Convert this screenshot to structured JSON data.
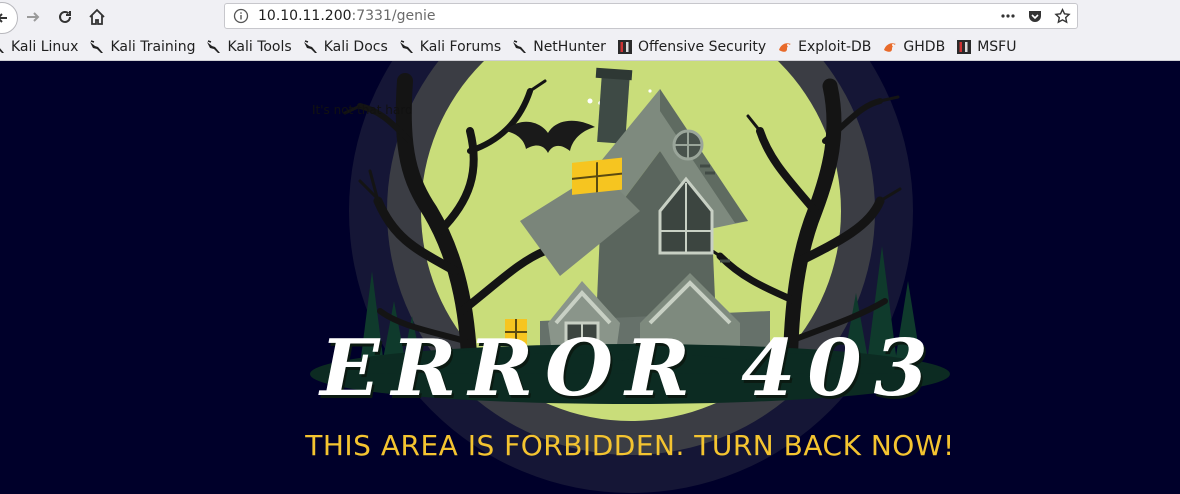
{
  "browser": {
    "url_host": "10.10.11.200",
    "url_rest": ":7331/genie"
  },
  "bookmarks": [
    {
      "label": "Kali Linux",
      "icon": "kali-dragon-icon"
    },
    {
      "label": "Kali Training",
      "icon": "kali-dragon-icon"
    },
    {
      "label": "Kali Tools",
      "icon": "kali-dragon-icon"
    },
    {
      "label": "Kali Docs",
      "icon": "kali-dragon-icon"
    },
    {
      "label": "Kali Forums",
      "icon": "kali-dragon-icon"
    },
    {
      "label": "NetHunter",
      "icon": "kali-dragon-icon"
    },
    {
      "label": "Offensive Security",
      "icon": "offsec-icon"
    },
    {
      "label": "Exploit-DB",
      "icon": "exploitdb-icon"
    },
    {
      "label": "GHDB",
      "icon": "exploitdb-icon"
    },
    {
      "label": "MSFU",
      "icon": "offsec-icon"
    }
  ],
  "page": {
    "hint_text": "It's not that hard",
    "error_title": "ERROR 403",
    "error_subtitle": "THIS AREA IS FORBIDDEN. TURN BACK NOW!"
  },
  "colors": {
    "background": "#00002a",
    "moon": "#c9dd7a",
    "subtitle": "#f4c430",
    "window_light": "#f6c520"
  }
}
